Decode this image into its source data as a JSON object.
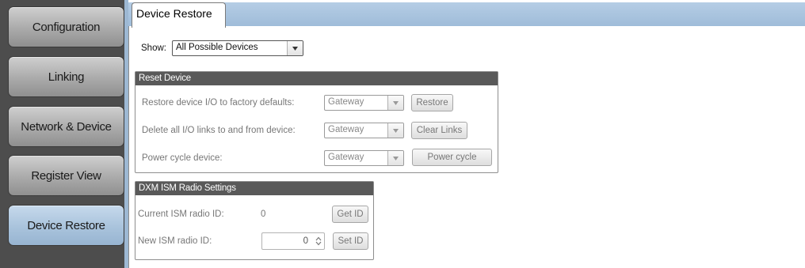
{
  "sidebar": {
    "items": [
      {
        "label": "Configuration"
      },
      {
        "label": "Linking"
      },
      {
        "label": "Network & Device"
      },
      {
        "label": "Register View"
      },
      {
        "label": "Device Restore",
        "active": true
      }
    ]
  },
  "tabs": [
    {
      "label": "Device Restore",
      "active": true
    }
  ],
  "show_filter": {
    "label": "Show:",
    "value": "All Possible Devices"
  },
  "reset_device": {
    "title": "Reset Device",
    "rows": [
      {
        "label": "Restore device I/O to factory defaults:",
        "device": "Gateway",
        "button": "Restore"
      },
      {
        "label": "Delete all I/O links to and from device:",
        "device": "Gateway",
        "button": "Clear Links"
      },
      {
        "label": "Power cycle device:",
        "device": "Gateway",
        "button": "Power cycle"
      }
    ]
  },
  "radio_settings": {
    "title": "DXM ISM Radio Settings",
    "current_label": "Current ISM radio ID:",
    "current_value": "0",
    "get_button": "Get ID",
    "new_label": "New ISM radio ID:",
    "new_value": "0",
    "set_button": "Set ID"
  },
  "colors": {
    "sidebar_bg": "#4d4d4d",
    "nav_active": "#a9c3dc",
    "tabstrip": "#a9c4df",
    "group_header": "#595959"
  }
}
